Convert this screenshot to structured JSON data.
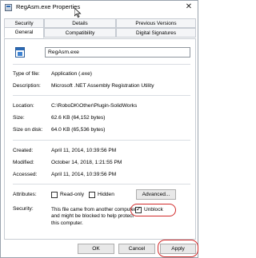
{
  "window": {
    "title": "RegAsm.exe Properties"
  },
  "tabs": {
    "row1": [
      {
        "label": "Security"
      },
      {
        "label": "Details"
      },
      {
        "label": "Previous Versions"
      }
    ],
    "row2": [
      {
        "label": "General",
        "active": true
      },
      {
        "label": "Compatibility"
      },
      {
        "label": "Digital Signatures"
      }
    ]
  },
  "general": {
    "file_name": "RegAsm.exe",
    "type_label": "Type of file:",
    "type_value": "Application (.exe)",
    "description_label": "Description:",
    "description_value": "Microsoft .NET Assembly Registration Utility",
    "location_label": "Location:",
    "location_value": "C:\\RoboDK\\Other\\Plugin-SolidWorks",
    "size_label": "Size:",
    "size_value": "62.6 KB (64,152 bytes)",
    "size_on_disk_label": "Size on disk:",
    "size_on_disk_value": "64.0 KB (65,536 bytes)",
    "created_label": "Created:",
    "created_value": "April 11, 2014, 10:39:56 PM",
    "modified_label": "Modified:",
    "modified_value": "October 14, 2018, 1:21:55 PM",
    "accessed_label": "Accessed:",
    "accessed_value": "April 11, 2014, 10:39:56 PM",
    "attributes_label": "Attributes:",
    "readonly_label": "Read-only",
    "readonly_checked": false,
    "hidden_label": "Hidden",
    "hidden_checked": false,
    "advanced_label": "Advanced...",
    "security_label": "Security:",
    "security_text": "This file came from another computer and might be blocked to help protect this computer.",
    "unblock_label": "Unblock",
    "unblock_checked": true
  },
  "footer": {
    "ok_label": "OK",
    "cancel_label": "Cancel",
    "apply_label": "Apply"
  },
  "colors": {
    "highlight_ring": "#d12b2b",
    "primary_border": "#3c7fd0"
  }
}
